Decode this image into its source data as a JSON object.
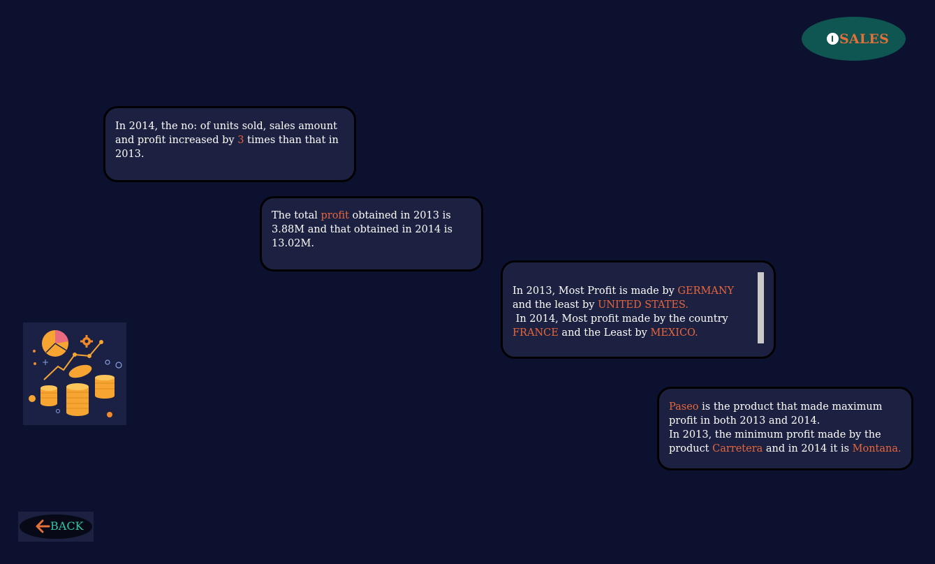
{
  "header": {
    "sales_label": "SALES",
    "icon": "power-icon"
  },
  "cards": [
    {
      "segments": [
        {
          "text": "In 2014, the no: of units sold, sales amount and profit increased by "
        },
        {
          "text": "3",
          "highlight": true
        },
        {
          "text": " times than that in 2013."
        }
      ]
    },
    {
      "segments": [
        {
          "text": "The total "
        },
        {
          "text": "profit",
          "highlight": true
        },
        {
          "text": " obtained in 2013 is 3.88M and that obtained in 2014 is 13.02M."
        }
      ]
    },
    {
      "segments": [
        {
          "text": "In 2013, Most Profit is made by "
        },
        {
          "text": "GERMANY",
          "highlight": true
        },
        {
          "text": " and the least by "
        },
        {
          "text": "UNITED STATES.",
          "highlight": true
        },
        {
          "br": true
        },
        {
          "text": " In 2014, Most profit made by the country "
        },
        {
          "text": "FRANCE",
          "highlight": true
        },
        {
          "text": " and the Least by "
        },
        {
          "text": "MEXICO.",
          "highlight": true
        }
      ]
    },
    {
      "segments": [
        {
          "text": "Paseo",
          "highlight": true
        },
        {
          "text": " is the product that made maximum profit in both 2013 and 2014."
        },
        {
          "br": true
        },
        {
          "text": "In 2013, the minimum profit made by the product "
        },
        {
          "text": "Carretera",
          "highlight": true
        },
        {
          "text": " and in 2014 it is "
        },
        {
          "text": "Montana.",
          "highlight": true
        }
      ]
    }
  ],
  "back_button": {
    "label": "BACK",
    "icon": "arrow-left-icon"
  },
  "illustration": {
    "icon": "finance-coins-chart-icon"
  },
  "colors": {
    "background": "#0d1130",
    "card": "#1c2142",
    "highlight": "#e8663b",
    "badge": "#0f5552",
    "back_text": "#31c6a4"
  }
}
